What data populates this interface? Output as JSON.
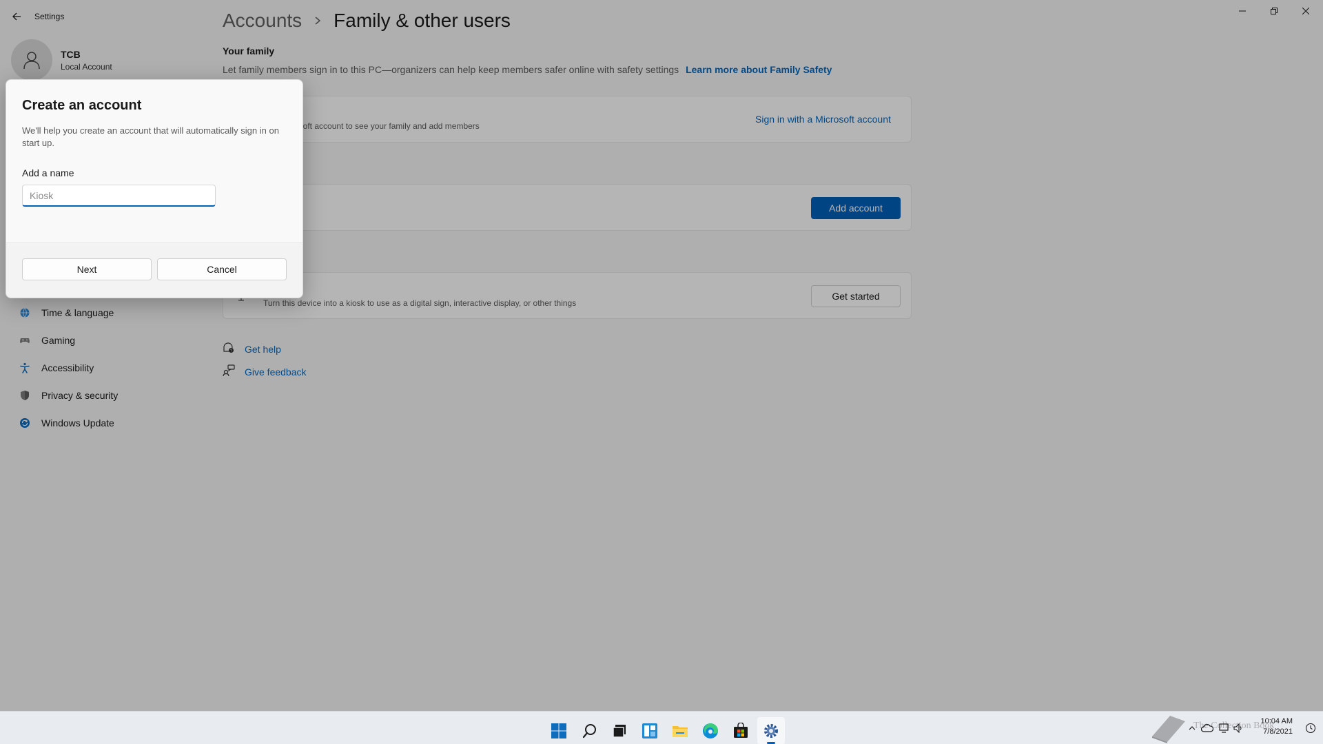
{
  "window": {
    "app_title": "Settings",
    "minimize_icon": "minimize-icon",
    "maximize_icon": "restore-icon",
    "close_icon": "close-icon"
  },
  "profile": {
    "name": "TCB",
    "account_type": "Local Account"
  },
  "sidebar": {
    "items": [
      {
        "label": "Time & language",
        "icon": "globe-clock-icon"
      },
      {
        "label": "Gaming",
        "icon": "gamepad-icon"
      },
      {
        "label": "Accessibility",
        "icon": "accessibility-icon"
      },
      {
        "label": "Privacy & security",
        "icon": "shield-icon"
      },
      {
        "label": "Windows Update",
        "icon": "update-icon"
      }
    ]
  },
  "breadcrumb": {
    "parent": "Accounts",
    "current": "Family & other users"
  },
  "your_family": {
    "title": "Your family",
    "description": "Let family members sign in to this PC—organizers can help keep members safer online with safety settings",
    "learn_more": "Learn more about Family Safety",
    "card_text": "osoft account to see your family and add members",
    "sign_in_link": "Sign in with a Microsoft account"
  },
  "other_users": {
    "add_account_button": "Add account"
  },
  "kiosk": {
    "card_text": "Turn this device into a kiosk to use as a digital sign, interactive display, or other things",
    "get_started_button": "Get started"
  },
  "help": {
    "get_help": "Get help",
    "give_feedback": "Give feedback"
  },
  "dialog": {
    "title": "Create an account",
    "description": "We'll help you create an account that will automatically sign in on start up.",
    "name_label": "Add a name",
    "name_value": "",
    "name_placeholder": "Kiosk",
    "next_button": "Next",
    "cancel_button": "Cancel"
  },
  "taskbar": {
    "apps": [
      "start-icon",
      "search-icon",
      "task-view-icon",
      "widgets-icon",
      "file-explorer-icon",
      "edge-icon",
      "store-icon",
      "settings-icon"
    ],
    "active_app": "settings-icon",
    "tray": [
      "chevron-up-icon",
      "cloud-icon",
      "network-icon",
      "volume-icon"
    ],
    "time": "10:04 AM",
    "date": "7/8/2021",
    "watermark": "The Collection Book"
  },
  "colors": {
    "accent": "#005fb8",
    "link": "#0067c0",
    "background": "#f3f3f3",
    "overlay": "rgba(0,0,0,0.28)"
  }
}
